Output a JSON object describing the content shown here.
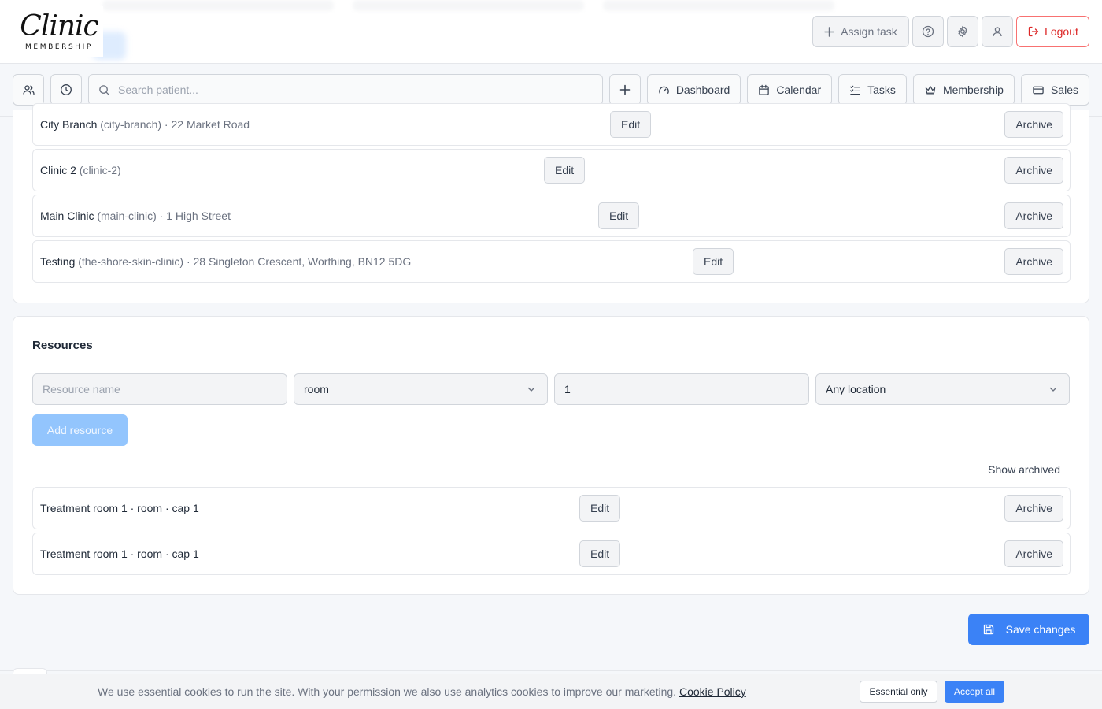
{
  "brand": {
    "logo_script": "Clinic",
    "logo_sub": "MEMBERSHIP"
  },
  "header": {
    "assign_task": "Assign task",
    "logout": "Logout"
  },
  "nav": {
    "search_placeholder": "Search patient...",
    "dashboard": "Dashboard",
    "calendar": "Calendar",
    "tasks": "Tasks",
    "membership": "Membership",
    "sales": "Sales"
  },
  "locations": {
    "edit_label": "Edit",
    "archive_label": "Archive",
    "items": [
      {
        "name": "City Branch",
        "detail": "(city-branch) · 22 Market Road"
      },
      {
        "name": "Clinic 2",
        "detail": "(clinic-2)"
      },
      {
        "name": "Main Clinic",
        "detail": "(main-clinic) · 1 High Street"
      },
      {
        "name": "Testing",
        "detail": "(the-shore-skin-clinic) · 28 Singleton Crescent, Worthing, BN12 5DG"
      }
    ]
  },
  "resources": {
    "title": "Resources",
    "name_placeholder": "Resource name",
    "type_value": "room",
    "capacity_value": "1",
    "location_value": "Any location",
    "add_label": "Add resource",
    "show_archived": "Show archived",
    "edit_label": "Edit",
    "archive_label": "Archive",
    "items": [
      {
        "label": "Treatment room 1 · room · cap 1"
      },
      {
        "label": "Treatment room 1 · room · cap 1"
      }
    ]
  },
  "save_label": "Save changes",
  "cookie": {
    "text": "We use essential cookies to run the site. With your permission we also use analytics cookies to improve our marketing.",
    "policy_link": "Cookie Policy",
    "essential": "Essential only",
    "accept": "Accept all"
  },
  "colors": {
    "primary": "#3b82f6",
    "primary_disabled": "#93c5fd",
    "danger": "#dc2626",
    "background": "#f5f7fa"
  }
}
